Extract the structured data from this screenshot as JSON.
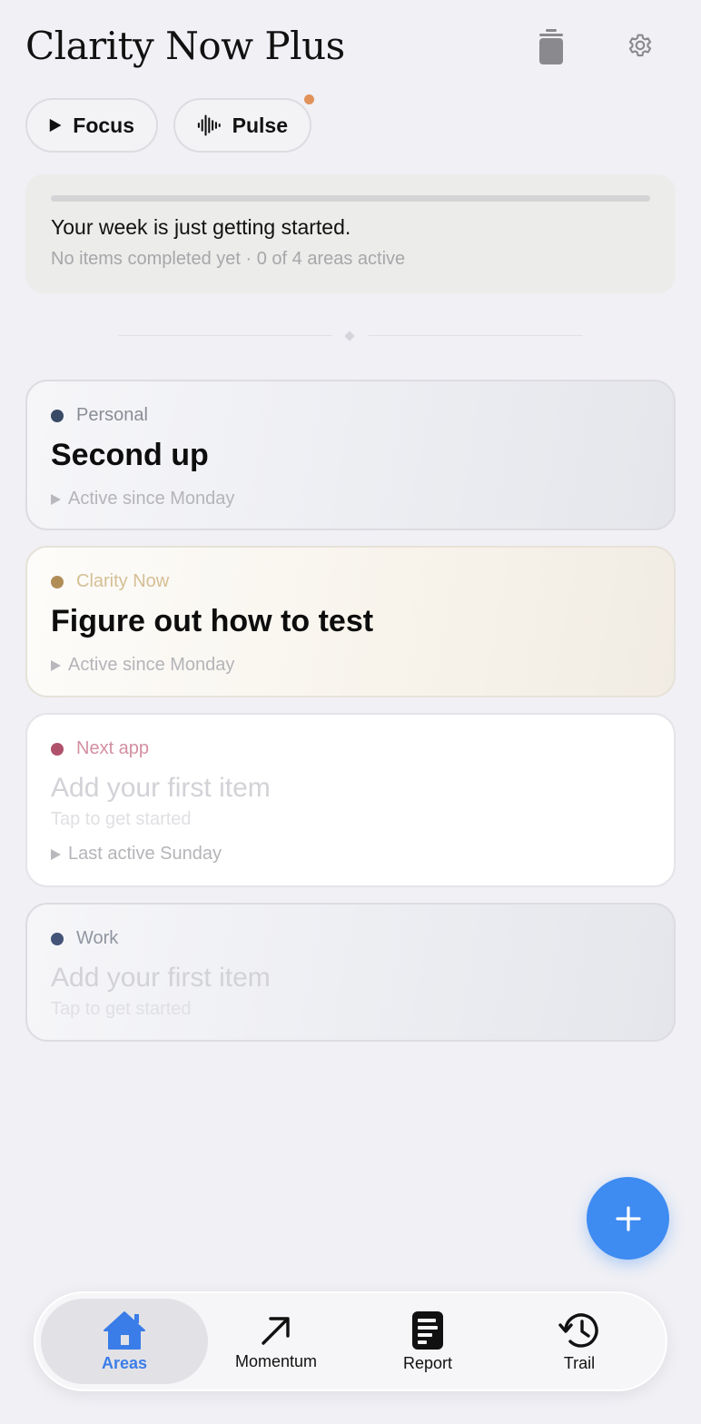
{
  "header": {
    "title": "Clarity Now Plus",
    "trash_icon": "trash-can-icon",
    "settings_icon": "gear-icon"
  },
  "chips": {
    "focus_label": "Focus",
    "pulse_label": "Pulse",
    "pulse_has_notification": true
  },
  "progress": {
    "fraction": 0,
    "headline": "Your week is just getting started.",
    "subtitle": "No items completed yet · 0 of 4 areas active"
  },
  "areas": [
    {
      "name": "Personal",
      "dot_color": "#394a66",
      "name_color": "#8a8d96",
      "title": "Second up",
      "status": "Active since Monday"
    },
    {
      "name": "Clarity Now",
      "dot_color": "#b08d57",
      "name_color": "#d4bf94",
      "title": "Figure out how to test",
      "status": "Active since Monday"
    },
    {
      "name": "Next app",
      "dot_color": "#b0516c",
      "name_color": "#d38fa1",
      "title": "Add your first item",
      "hint": "Tap to get started",
      "status": "Last active Sunday"
    },
    {
      "name": "Work",
      "dot_color": "#445478",
      "name_color": "#9095a0",
      "title": "Add your first item",
      "hint": "Tap to get started"
    }
  ],
  "fab": {
    "icon": "plus-icon",
    "color": "#3e8bf2"
  },
  "tabbar": {
    "tabs": [
      {
        "label": "Areas",
        "icon": "house-icon",
        "active": true
      },
      {
        "label": "Momentum",
        "icon": "arrow-up-right-icon",
        "active": false
      },
      {
        "label": "Report",
        "icon": "report-icon",
        "active": false
      },
      {
        "label": "Trail",
        "icon": "history-icon",
        "active": false
      }
    ]
  }
}
